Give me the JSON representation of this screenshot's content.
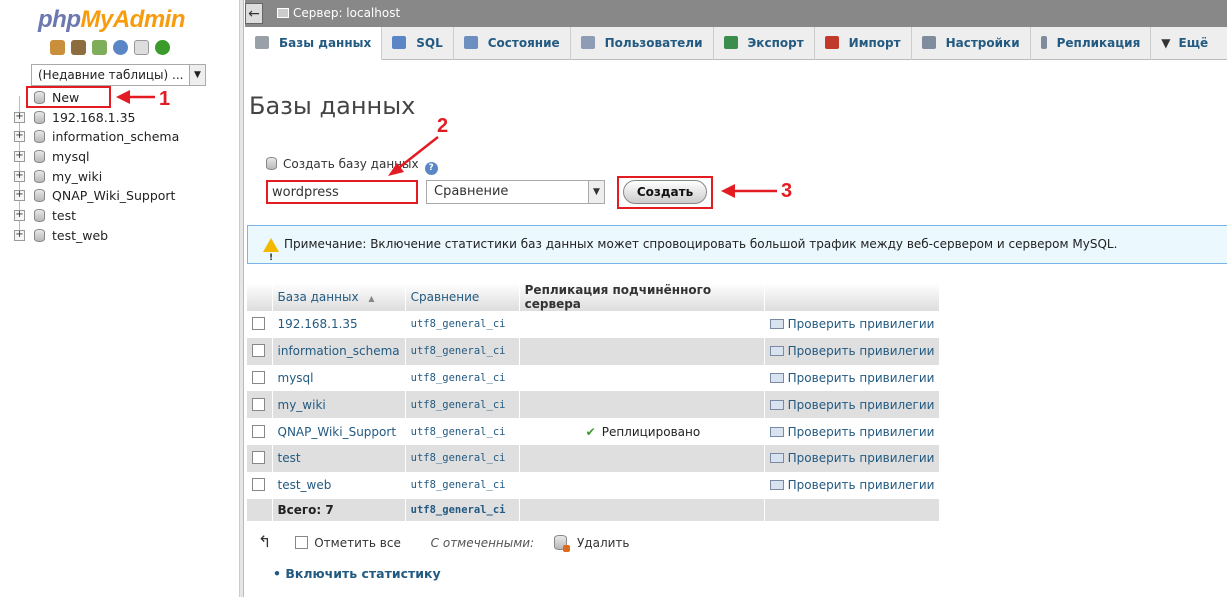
{
  "logo": {
    "part1": "php",
    "part2": "MyAdmin"
  },
  "nav_icons": [
    "home-icon",
    "logout-icon",
    "sql-query-icon",
    "help-icon",
    "docs-icon",
    "reload-icon"
  ],
  "recent_tables": "(Недавние таблицы) ...",
  "tree": {
    "new_label": "New",
    "databases": [
      "192.168.1.35",
      "information_schema",
      "mysql",
      "my_wiki",
      "QNAP_Wiki_Support",
      "test",
      "test_web"
    ]
  },
  "topbar": {
    "server": "Сервер: localhost"
  },
  "tabs": [
    "Базы данных",
    "SQL",
    "Состояние",
    "Пользователи",
    "Экспорт",
    "Импорт",
    "Настройки",
    "Репликация",
    "Ещё"
  ],
  "tab_colors": [
    "#9aa0a8",
    "#5b86c5",
    "#6c8fbf",
    "#8e9db5",
    "#3a8d4a",
    "#c0392b",
    "#7f8c9d",
    "#7f8c9d",
    "#333333"
  ],
  "page_title": "Базы данных",
  "create": {
    "label": "Создать базу данных",
    "dbname_value": "wordpress",
    "collation": "Сравнение",
    "button": "Создать"
  },
  "notice": "Примечание: Включение статистики баз данных может спровоцировать большой трафик между веб-сервером и сервером MySQL.",
  "table": {
    "headers": {
      "db": "База данных",
      "sort": "▲",
      "collation": "Сравнение",
      "replication": "Репликация подчинённого сервера"
    },
    "rows": [
      {
        "name": "192.168.1.35",
        "collation": "utf8_general_ci",
        "replication": "",
        "priv": "Проверить привилегии"
      },
      {
        "name": "information_schema",
        "collation": "utf8_general_ci",
        "replication": "",
        "priv": "Проверить привилегии"
      },
      {
        "name": "mysql",
        "collation": "utf8_general_ci",
        "replication": "",
        "priv": "Проверить привилегии"
      },
      {
        "name": "my_wiki",
        "collation": "utf8_general_ci",
        "replication": "",
        "priv": "Проверить привилегии"
      },
      {
        "name": "QNAP_Wiki_Support",
        "collation": "utf8_general_ci",
        "replication": "Реплицировано",
        "priv": "Проверить привилегии"
      },
      {
        "name": "test",
        "collation": "utf8_general_ci",
        "replication": "",
        "priv": "Проверить привилегии"
      },
      {
        "name": "test_web",
        "collation": "utf8_general_ci",
        "replication": "",
        "priv": "Проверить привилегии"
      }
    ],
    "total_label": "Всего: 7",
    "total_collation": "utf8_general_ci"
  },
  "footer": {
    "check_all": "Отметить все",
    "with_selected": "С отмеченными:",
    "delete": "Удалить"
  },
  "stats_link": "Включить статистику",
  "annotations": [
    "1",
    "2",
    "3"
  ],
  "annotation_color": "#e31c23"
}
